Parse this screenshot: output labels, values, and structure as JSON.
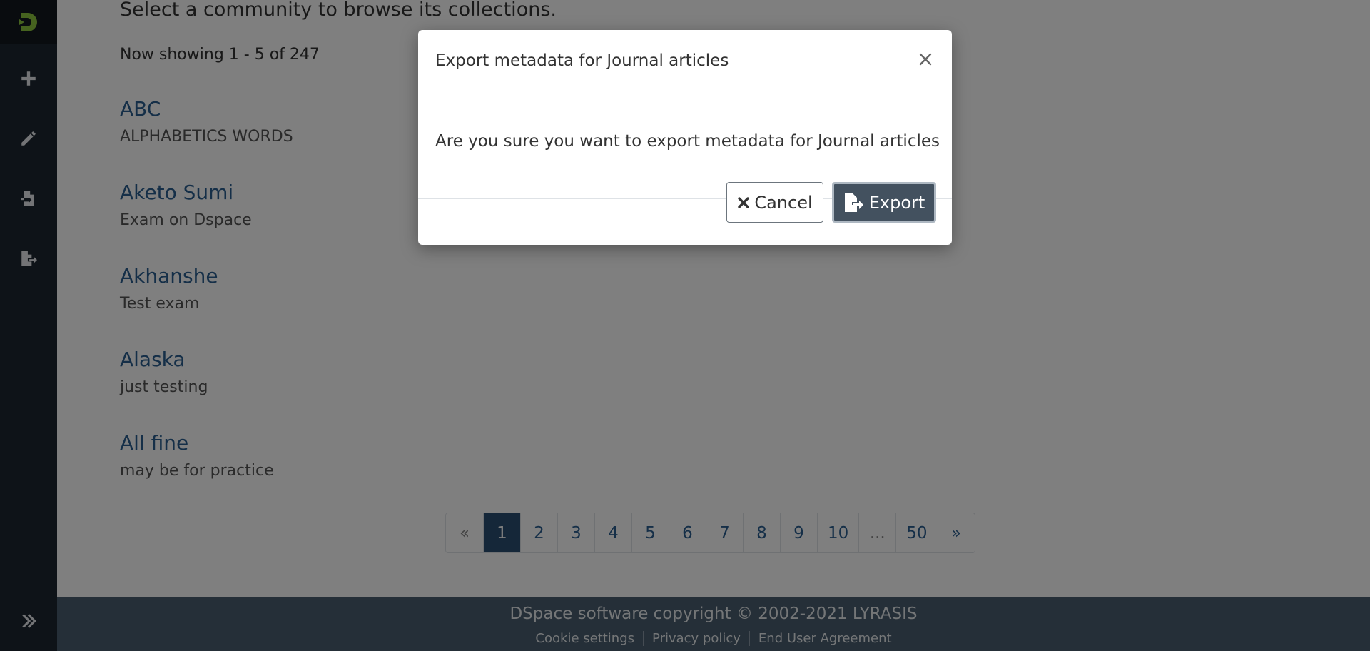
{
  "sidebar": {
    "logo": "dspace-logo",
    "items": [
      {
        "icon": "plus-icon"
      },
      {
        "icon": "pencil-icon"
      },
      {
        "icon": "import-icon"
      },
      {
        "icon": "export-icon"
      }
    ],
    "toggle": "double-chevron-right-icon"
  },
  "main": {
    "intro_text": "Select a community to browse its collections.",
    "showing_text": "Now showing 1 - 5 of 247",
    "communities": [
      {
        "title": "ABC",
        "description": "ALPHABETICS WORDS"
      },
      {
        "title": "Aketo Sumi",
        "description": "Exam on Dspace"
      },
      {
        "title": "Akhanshe",
        "description": "Test exam"
      },
      {
        "title": "Alaska",
        "description": "just testing"
      },
      {
        "title": "All fine",
        "description": "may be for practice"
      }
    ],
    "pagination": {
      "prev": "«",
      "pages": [
        "1",
        "2",
        "3",
        "4",
        "5",
        "6",
        "7",
        "8",
        "9",
        "10",
        "...",
        "50"
      ],
      "next": "»",
      "current": "1"
    }
  },
  "footer": {
    "copyright": "DSpace software copyright © 2002-2021 LYRASIS",
    "links": [
      "Cookie settings",
      "Privacy policy",
      "End User Agreement"
    ]
  },
  "modal": {
    "title": "Export metadata for Journal articles",
    "body": "Are you sure you want to export metadata for Journal articles",
    "cancel_label": "Cancel",
    "export_label": "Export"
  },
  "colors": {
    "sidebar_bg": "#1d2731",
    "link": "#2b5f91",
    "footer_bg": "#4b5f71",
    "export_button": "#43515f",
    "logo_accent": "#8dc63f"
  }
}
